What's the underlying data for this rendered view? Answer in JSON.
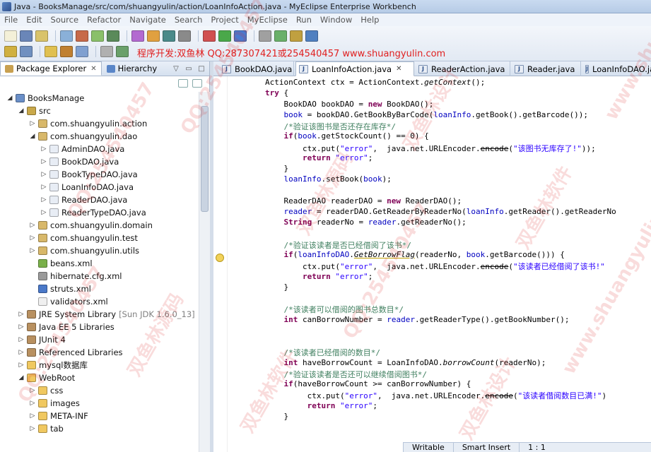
{
  "window": {
    "title": "Java - BooksManage/src/com/shuangyulin/action/LoanInfoAction.java - MyEclipse Enterprise Workbench"
  },
  "menu": [
    "File",
    "Edit",
    "Source",
    "Refactor",
    "Navigate",
    "Search",
    "Project",
    "MyEclipse",
    "Run",
    "Window",
    "Help"
  ],
  "banner": "程序开发:双鱼林 QQ:287307421或254540457 www.shuangyulin.com",
  "left_panel": {
    "tabs": [
      {
        "label": "Package Explorer",
        "active": true
      },
      {
        "label": "Hierarchy",
        "active": false
      }
    ],
    "tree": [
      {
        "label": "BooksManage",
        "indent": 0,
        "twisty": "open",
        "icon": "project-icon",
        "suffix": ""
      },
      {
        "label": "src",
        "indent": 1,
        "twisty": "open",
        "icon": "source-folder-icon",
        "suffix": ""
      },
      {
        "label": "com.shuangyulin.action",
        "indent": 2,
        "twisty": "closed",
        "icon": "package-icon",
        "suffix": ""
      },
      {
        "label": "com.shuangyulin.dao",
        "indent": 2,
        "twisty": "open",
        "icon": "package-icon",
        "suffix": ""
      },
      {
        "label": "AdminDAO.java",
        "indent": 3,
        "twisty": "closed",
        "icon": "java-file-icon",
        "suffix": ""
      },
      {
        "label": "BookDAO.java",
        "indent": 3,
        "twisty": "closed",
        "icon": "java-file-icon",
        "suffix": ""
      },
      {
        "label": "BookTypeDAO.java",
        "indent": 3,
        "twisty": "closed",
        "icon": "java-file-icon",
        "suffix": ""
      },
      {
        "label": "LoanInfoDAO.java",
        "indent": 3,
        "twisty": "closed",
        "icon": "java-file-icon",
        "suffix": ""
      },
      {
        "label": "ReaderDAO.java",
        "indent": 3,
        "twisty": "closed",
        "icon": "java-file-icon",
        "suffix": ""
      },
      {
        "label": "ReaderTypeDAO.java",
        "indent": 3,
        "twisty": "closed",
        "icon": "java-file-icon",
        "suffix": ""
      },
      {
        "label": "com.shuangyulin.domain",
        "indent": 2,
        "twisty": "closed",
        "icon": "package-icon",
        "suffix": ""
      },
      {
        "label": "com.shuangyulin.test",
        "indent": 2,
        "twisty": "closed",
        "icon": "package-icon",
        "suffix": ""
      },
      {
        "label": "com.shuangyulin.utils",
        "indent": 2,
        "twisty": "closed",
        "icon": "package-icon",
        "suffix": ""
      },
      {
        "label": "beans.xml",
        "indent": 2,
        "twisty": "none",
        "icon": "beans-file-icon",
        "suffix": ""
      },
      {
        "label": "hibernate.cfg.xml",
        "indent": 2,
        "twisty": "none",
        "icon": "hibernate-file-icon",
        "suffix": ""
      },
      {
        "label": "struts.xml",
        "indent": 2,
        "twisty": "none",
        "icon": "struts-file-icon",
        "suffix": ""
      },
      {
        "label": "validators.xml",
        "indent": 2,
        "twisty": "none",
        "icon": "xml-file-icon",
        "suffix": ""
      },
      {
        "label": "JRE System Library",
        "indent": 1,
        "twisty": "closed",
        "icon": "library-icon",
        "suffix": "[Sun JDK 1.6.0_13]"
      },
      {
        "label": "Java EE 5 Libraries",
        "indent": 1,
        "twisty": "closed",
        "icon": "library-icon",
        "suffix": ""
      },
      {
        "label": "JUnit 4",
        "indent": 1,
        "twisty": "closed",
        "icon": "library-icon",
        "suffix": ""
      },
      {
        "label": "Referenced Libraries",
        "indent": 1,
        "twisty": "closed",
        "icon": "library-icon",
        "suffix": ""
      },
      {
        "label": "mysql数据库",
        "indent": 1,
        "twisty": "closed",
        "icon": "folder-icon",
        "suffix": ""
      },
      {
        "label": "WebRoot",
        "indent": 1,
        "twisty": "open",
        "icon": "folder-icon",
        "suffix": ""
      },
      {
        "label": "css",
        "indent": 2,
        "twisty": "closed",
        "icon": "folder-icon",
        "suffix": ""
      },
      {
        "label": "images",
        "indent": 2,
        "twisty": "closed",
        "icon": "folder-icon",
        "suffix": ""
      },
      {
        "label": "META-INF",
        "indent": 2,
        "twisty": "closed",
        "icon": "folder-icon",
        "suffix": ""
      },
      {
        "label": "tab",
        "indent": 2,
        "twisty": "closed",
        "icon": "folder-icon",
        "suffix": ""
      }
    ]
  },
  "editor": {
    "tabs": [
      {
        "label": "BookDAO.java",
        "active": false
      },
      {
        "label": "LoanInfoAction.java",
        "active": true
      },
      {
        "label": "ReaderAction.java",
        "active": false
      },
      {
        "label": "Reader.java",
        "active": false
      },
      {
        "label": "LoanInfoDAO.java",
        "active": false
      }
    ],
    "lines": [
      "        ActionContext ctx = ActionContext.getContext();",
      "        try {",
      "            BookDAO bookDAO = new BookDAO();",
      "            book = bookDAO.GetBookByBarCode(loanInfo.getBook().getBarcode());",
      "            /*验证该图书是否还存在库存*/",
      "            if(book.getStockCount() == 0) {",
      "                ctx.put(\"error\",  java.net.URLEncoder.encode(\"该图书无库存了!\"));",
      "                return \"error\";",
      "            }",
      "            loanInfo.setBook(book);",
      "",
      "            ReaderDAO readerDAO = new ReaderDAO();",
      "            reader = readerDAO.GetReaderByReaderNo(loanInfo.getReader().getReaderNo",
      "            String readerNo = reader.getReaderNo();",
      "",
      "            /*验证该读者是否已经借阅了该书*/",
      "            if(loanInfoDAO.GetBorrowFlag(readerNo, book.getBarcode())) {",
      "                ctx.put(\"error\",  java.net.URLEncoder.encode(\"该读者已经借阅了该书!\"",
      "                return \"error\";",
      "            }",
      "",
      "            /*该读者可以借阅的图书总数目*/",
      "            int canBorrowNumber = reader.getReaderType().getBookNumber();",
      "",
      "",
      "            /*该读者已经借阅的数目*/",
      "            int haveBorrowCount = LoanInfoDAO.borrowCount(readerNo);",
      "            /*验证该读者是否还可以继续借阅图书*/",
      "            if(haveBorrowCount >= canBorrowNumber) {",
      "                 ctx.put(\"error\",  java.net.URLEncoder.encode(\"该读者借阅数目已满!\")",
      "                 return \"error\";",
      "            }"
    ]
  },
  "status": {
    "writable": "Writable",
    "insert_mode": "Smart Insert",
    "position": "1 : 1"
  },
  "watermark": [
    "QQ:254540457",
    "双鱼林源码",
    "双鱼林软件",
    "QQ:254540457",
    "双鱼林设计",
    "www.shuangyulin.com"
  ]
}
